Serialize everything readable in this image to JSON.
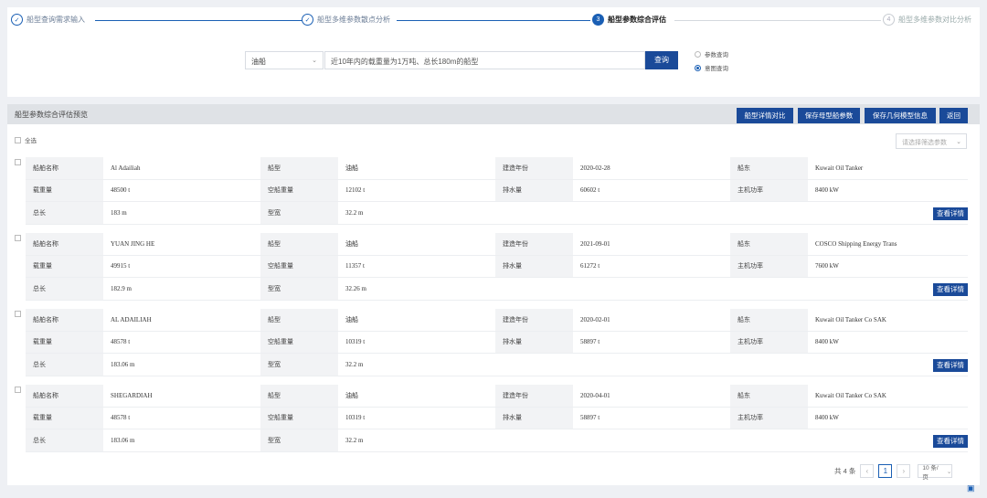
{
  "stepper": {
    "steps": [
      {
        "label": "船型查询需求输入",
        "mark": "✓"
      },
      {
        "label": "船型多维参数散点分析",
        "mark": "✓"
      },
      {
        "label": "船型参数综合评估",
        "mark": "3"
      },
      {
        "label": "船型多维参数对比分析",
        "mark": "4"
      }
    ]
  },
  "query": {
    "ship_type": "油船",
    "input_value": "近10年内的载重量为1万吨、总长180m的船型",
    "search_label": "查询",
    "radio_options": [
      "参数查询",
      "意图查询"
    ],
    "selected_radio": "意图查询"
  },
  "panel": {
    "title": "船型参数综合评估预览",
    "buttons": [
      "船型详情对比",
      "保存母型船参数",
      "保存几何模型信息",
      "返回"
    ],
    "select_all": "全选",
    "param_select_placeholder": "请选择筛选参数"
  },
  "labels": {
    "name": "船舶名称",
    "type": "船型",
    "year": "建造年份",
    "owner": "船东",
    "dwt": "载重量",
    "lightship": "空船重量",
    "displacement": "排水量",
    "power": "主机功率",
    "length": "总长",
    "beam": "型宽",
    "detail": "查看详情"
  },
  "ships": [
    {
      "name": "Al Adailiah",
      "type": "油船",
      "year": "2020-02-28",
      "owner": "Kuwait Oil Tanker",
      "dwt": "48500 t",
      "lightship": "12102 t",
      "displacement": "60602 t",
      "power": "8400 kW",
      "length": "183 m",
      "beam": "32.2 m"
    },
    {
      "name": "YUAN JING HE",
      "type": "油船",
      "year": "2021-09-01",
      "owner": "COSCO Shipping Energy Trans",
      "dwt": "49915 t",
      "lightship": "11357 t",
      "displacement": "61272 t",
      "power": "7600 kW",
      "length": "182.9 m",
      "beam": "32.26 m"
    },
    {
      "name": "AL ADAILIAH",
      "type": "油船",
      "year": "2020-02-01",
      "owner": "Kuwait Oil Tanker Co SAK",
      "dwt": "48578 t",
      "lightship": "10319 t",
      "displacement": "58897 t",
      "power": "8400 kW",
      "length": "183.06 m",
      "beam": "32.2 m"
    },
    {
      "name": "SHEGARDIAH",
      "type": "油船",
      "year": "2020-04-01",
      "owner": "Kuwait Oil Tanker Co SAK",
      "dwt": "48578 t",
      "lightship": "10319 t",
      "displacement": "58897 t",
      "power": "8400 kW",
      "length": "183.06 m",
      "beam": "32.2 m"
    }
  ],
  "pagination": {
    "total": "共 4 条",
    "prev": "‹",
    "current": "1",
    "next": "›",
    "page_size": "10 条/页"
  }
}
